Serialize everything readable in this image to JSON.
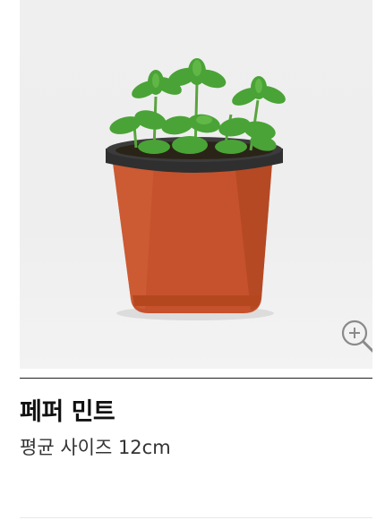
{
  "product": {
    "name": "페퍼 민트",
    "size_text": "평균 사이즈 12cm"
  },
  "icons": {
    "zoom": "zoom-in-icon"
  },
  "colors": {
    "pot": "#c5522c",
    "leaf": "#4aa336",
    "background": "#eeeeee",
    "divider": "#222222"
  }
}
